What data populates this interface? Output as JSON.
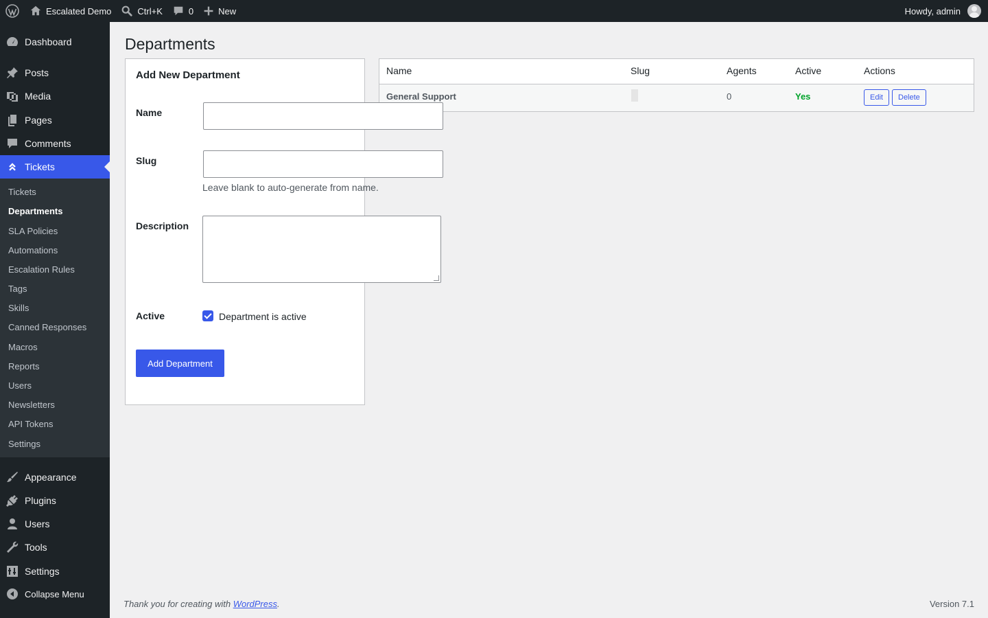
{
  "adminbar": {
    "site_name": "Escalated Demo",
    "search_shortcut": "Ctrl+K",
    "comments_count": "0",
    "new_label": "New",
    "howdy": "Howdy, admin"
  },
  "menu": {
    "dashboard": "Dashboard",
    "posts": "Posts",
    "media": "Media",
    "pages": "Pages",
    "comments": "Comments",
    "tickets": "Tickets",
    "submenu": [
      "Tickets",
      "Departments",
      "SLA Policies",
      "Automations",
      "Escalation Rules",
      "Tags",
      "Skills",
      "Canned Responses",
      "Macros",
      "Reports",
      "Users",
      "Newsletters",
      "API Tokens",
      "Settings"
    ],
    "appearance": "Appearance",
    "plugins": "Plugins",
    "users": "Users",
    "tools": "Tools",
    "settings": "Settings",
    "collapse": "Collapse Menu"
  },
  "page": {
    "title": "Departments"
  },
  "form": {
    "heading": "Add New Department",
    "name_label": "Name",
    "name_value": "",
    "slug_label": "Slug",
    "slug_value": "",
    "slug_help": "Leave blank to auto-generate from name.",
    "description_label": "Description",
    "description_value": "",
    "active_label": "Active",
    "active_checkbox_label": "Department is active",
    "active_checked": true,
    "submit_label": "Add Department"
  },
  "table": {
    "columns": [
      "Name",
      "Slug",
      "Agents",
      "Active",
      "Actions"
    ],
    "rows": [
      {
        "name": "General Support",
        "slug": "",
        "agents": "0",
        "active": "Yes",
        "edit": "Edit",
        "delete": "Delete"
      }
    ]
  },
  "footer": {
    "thanks_prefix": "Thank you for creating with ",
    "link": "WordPress",
    "suffix": ".",
    "version": "Version 7.1"
  },
  "colors": {
    "accent": "#3858e9",
    "sidebar_bg": "#1d2327",
    "submenu_bg": "#2c3338",
    "active_green": "#00a32a"
  }
}
